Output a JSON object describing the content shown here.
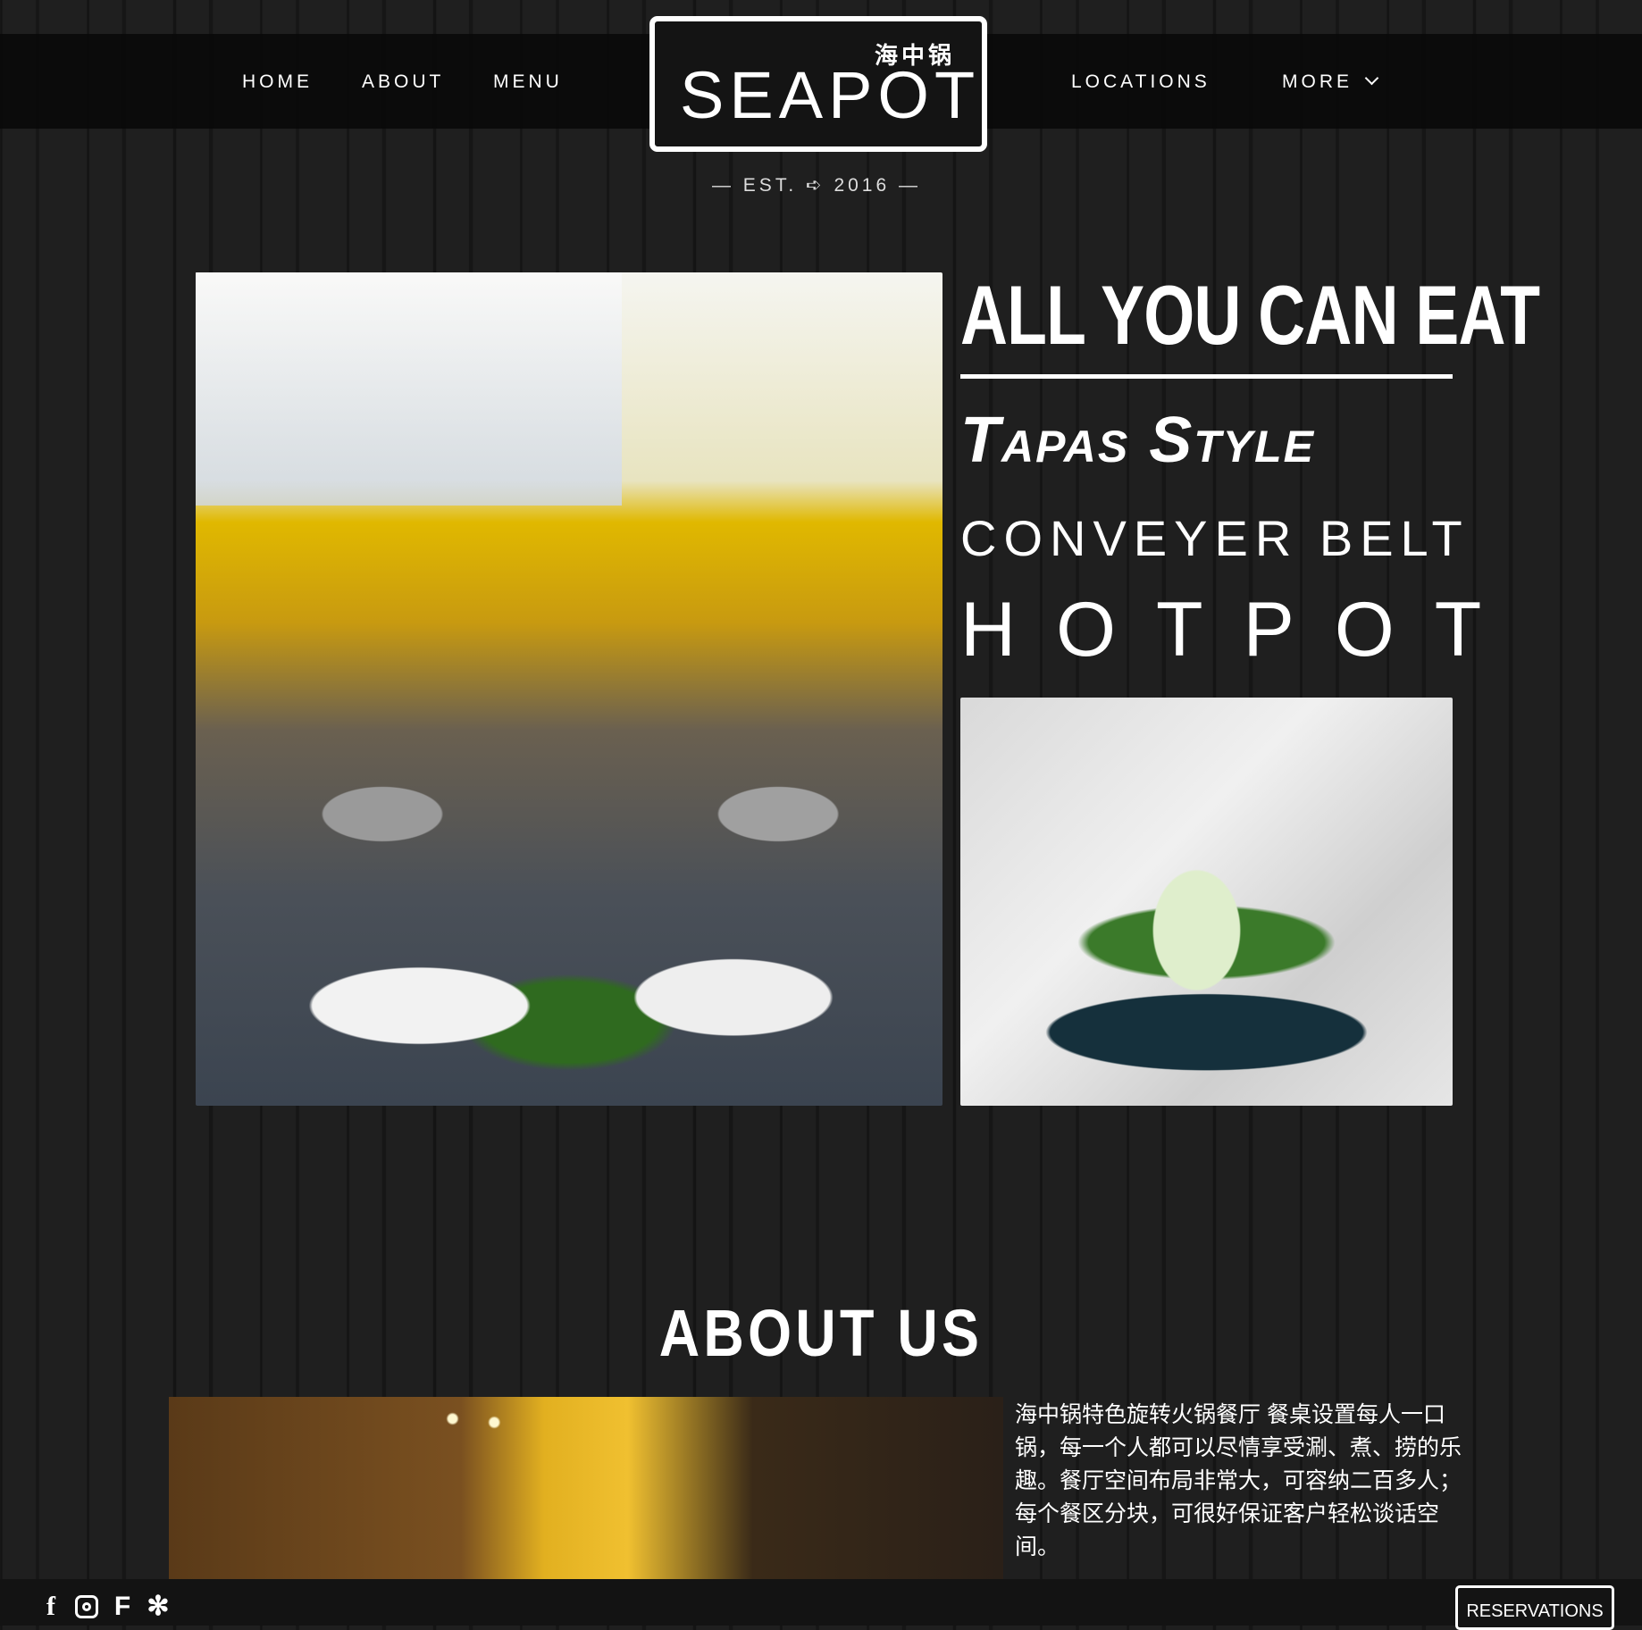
{
  "nav": {
    "left": [
      "HOME",
      "ABOUT",
      "MENU"
    ],
    "right": [
      "LOCATIONS",
      "MORE"
    ],
    "more_icon": "chevron-down-icon"
  },
  "logo": {
    "chinese": "海中锅",
    "name": "SEAPOT"
  },
  "est": {
    "prefix": "— EST.",
    "icon": "fish-icon",
    "year": "2016 —"
  },
  "hero": {
    "line1": "ALL YOU CAN EAT",
    "line2": "Tapas Style",
    "line3": "CONVEYER BELT",
    "line4": "HOTPOT"
  },
  "about": {
    "title": "ABOUT US",
    "text": "海中锅特色旋转火锅餐厅 餐桌设置每人一口锅，每一个人都可以尽情享受涮、煮、捞的乐趣。餐厅空间布局非常大，可容纳二百多人；每个餐区分块，可很好保证客户轻松谈话空间。"
  },
  "footer": {
    "social": [
      "facebook-icon",
      "instagram-icon",
      "foursquare-icon",
      "yelp-icon"
    ],
    "reservations": "RESERVATIONS"
  }
}
